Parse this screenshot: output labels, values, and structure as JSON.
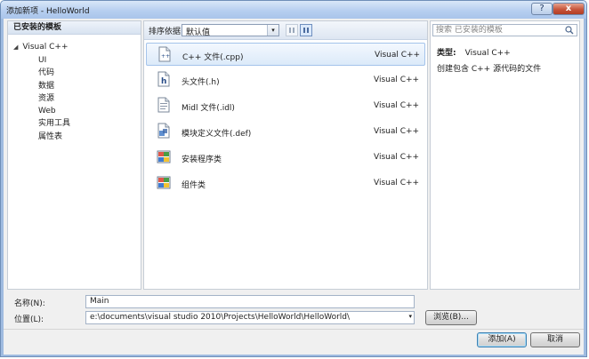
{
  "window": {
    "title": "添加新项 - HelloWorld",
    "help_glyph": "?",
    "close_glyph": "x"
  },
  "left_panel": {
    "header": "已安装的模板",
    "tree_toggle": "◢",
    "root": "Visual C++",
    "children": [
      "UI",
      "代码",
      "数据",
      "资源",
      "Web",
      "实用工具",
      "属性表"
    ]
  },
  "toolbar": {
    "sort_label": "排序依据:",
    "sort_value": "默认值",
    "dropdown_glyph": "▾"
  },
  "templates": [
    {
      "name": "C++ 文件(.cpp)",
      "type": "Visual C++",
      "icon": "cpp-file-icon",
      "selected": true
    },
    {
      "name": "头文件(.h)",
      "type": "Visual C++",
      "icon": "header-file-icon",
      "selected": false
    },
    {
      "name": "Midl 文件(.idl)",
      "type": "Visual C++",
      "icon": "midl-file-icon",
      "selected": false
    },
    {
      "name": "模块定义文件(.def)",
      "type": "Visual C++",
      "icon": "def-file-icon",
      "selected": false
    },
    {
      "name": "安装程序类",
      "type": "Visual C++",
      "icon": "installer-class-icon",
      "selected": false
    },
    {
      "name": "组件类",
      "type": "Visual C++",
      "icon": "component-class-icon",
      "selected": false
    }
  ],
  "details": {
    "search_placeholder": "搜索 已安装的模板",
    "type_label": "类型:",
    "type_value": "Visual C++",
    "description": "创建包含 C++ 源代码的文件"
  },
  "form": {
    "name_label": "名称(N):",
    "name_value": "Main",
    "location_label": "位置(L):",
    "location_value": "e:\\documents\\visual studio 2010\\Projects\\HelloWorld\\HelloWorld\\",
    "browse_label": "浏览(B)..."
  },
  "buttons": {
    "add": "添加(A)",
    "cancel": "取消"
  },
  "colors": {
    "selection_fill": "#dceaf9",
    "selection_border": "#a4c3eb",
    "title_bar": "#b7cff0",
    "close_button": "#c7553b"
  }
}
